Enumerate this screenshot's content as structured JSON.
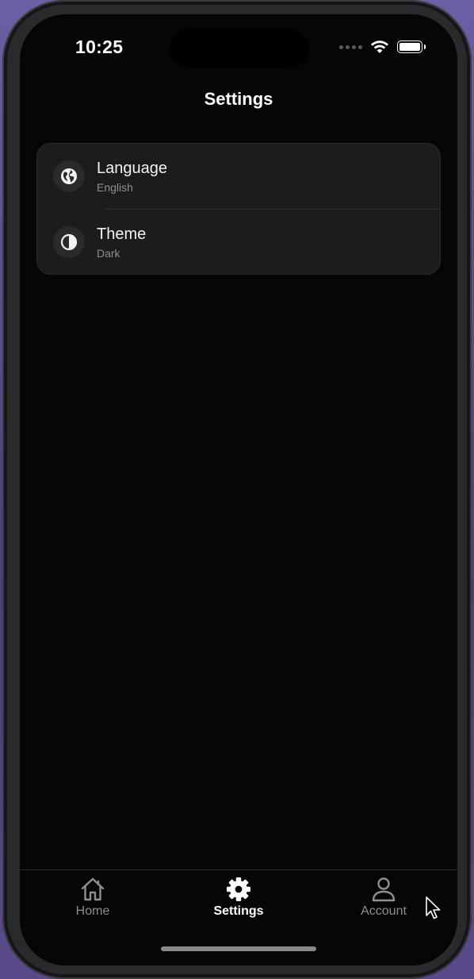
{
  "status_bar": {
    "time": "10:25"
  },
  "header": {
    "title": "Settings"
  },
  "settings": {
    "items": [
      {
        "label": "Language",
        "value": "English",
        "icon": "globe-icon"
      },
      {
        "label": "Theme",
        "value": "Dark",
        "icon": "contrast-icon"
      }
    ]
  },
  "tabbar": {
    "tabs": [
      {
        "label": "Home",
        "icon": "home-icon",
        "active": false
      },
      {
        "label": "Settings",
        "icon": "gear-icon",
        "active": true
      },
      {
        "label": "Account",
        "icon": "person-icon",
        "active": false
      }
    ]
  },
  "colors": {
    "background": "#060608",
    "card": "#1c1c1e",
    "text_primary": "#ffffff",
    "text_secondary": "#8e8e93",
    "device_backdrop": "#5b4f8f"
  }
}
